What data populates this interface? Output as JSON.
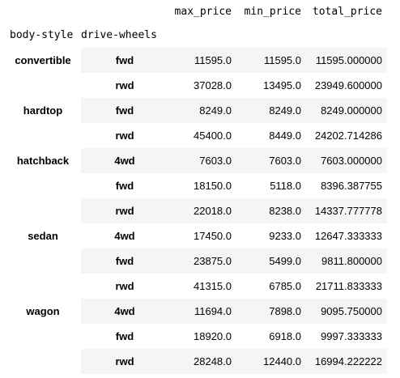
{
  "table": {
    "columns": [
      "max_price",
      "min_price",
      "total_price"
    ],
    "index_names": [
      "body-style",
      "drive-wheels"
    ],
    "groups": [
      {
        "body_style": "convertible",
        "rows": [
          {
            "drive": "fwd",
            "max_price": "11595.0",
            "min_price": "11595.0",
            "total_price": "11595.000000"
          },
          {
            "drive": "rwd",
            "max_price": "37028.0",
            "min_price": "13495.0",
            "total_price": "23949.600000"
          }
        ]
      },
      {
        "body_style": "hardtop",
        "rows": [
          {
            "drive": "fwd",
            "max_price": "8249.0",
            "min_price": "8249.0",
            "total_price": "8249.000000"
          },
          {
            "drive": "rwd",
            "max_price": "45400.0",
            "min_price": "8449.0",
            "total_price": "24202.714286"
          }
        ]
      },
      {
        "body_style": "hatchback",
        "rows": [
          {
            "drive": "4wd",
            "max_price": "7603.0",
            "min_price": "7603.0",
            "total_price": "7603.000000"
          },
          {
            "drive": "fwd",
            "max_price": "18150.0",
            "min_price": "5118.0",
            "total_price": "8396.387755"
          },
          {
            "drive": "rwd",
            "max_price": "22018.0",
            "min_price": "8238.0",
            "total_price": "14337.777778"
          }
        ]
      },
      {
        "body_style": "sedan",
        "rows": [
          {
            "drive": "4wd",
            "max_price": "17450.0",
            "min_price": "9233.0",
            "total_price": "12647.333333"
          },
          {
            "drive": "fwd",
            "max_price": "23875.0",
            "min_price": "5499.0",
            "total_price": "9811.800000"
          },
          {
            "drive": "rwd",
            "max_price": "41315.0",
            "min_price": "6785.0",
            "total_price": "21711.833333"
          }
        ]
      },
      {
        "body_style": "wagon",
        "rows": [
          {
            "drive": "4wd",
            "max_price": "11694.0",
            "min_price": "7898.0",
            "total_price": "9095.750000"
          },
          {
            "drive": "fwd",
            "max_price": "18920.0",
            "min_price": "6918.0",
            "total_price": "9997.333333"
          },
          {
            "drive": "rwd",
            "max_price": "28248.0",
            "min_price": "12440.0",
            "total_price": "16994.222222"
          }
        ]
      }
    ]
  },
  "colors": {
    "stripe": "#f5f5f5",
    "text": "#000000",
    "background": "#ffffff"
  }
}
